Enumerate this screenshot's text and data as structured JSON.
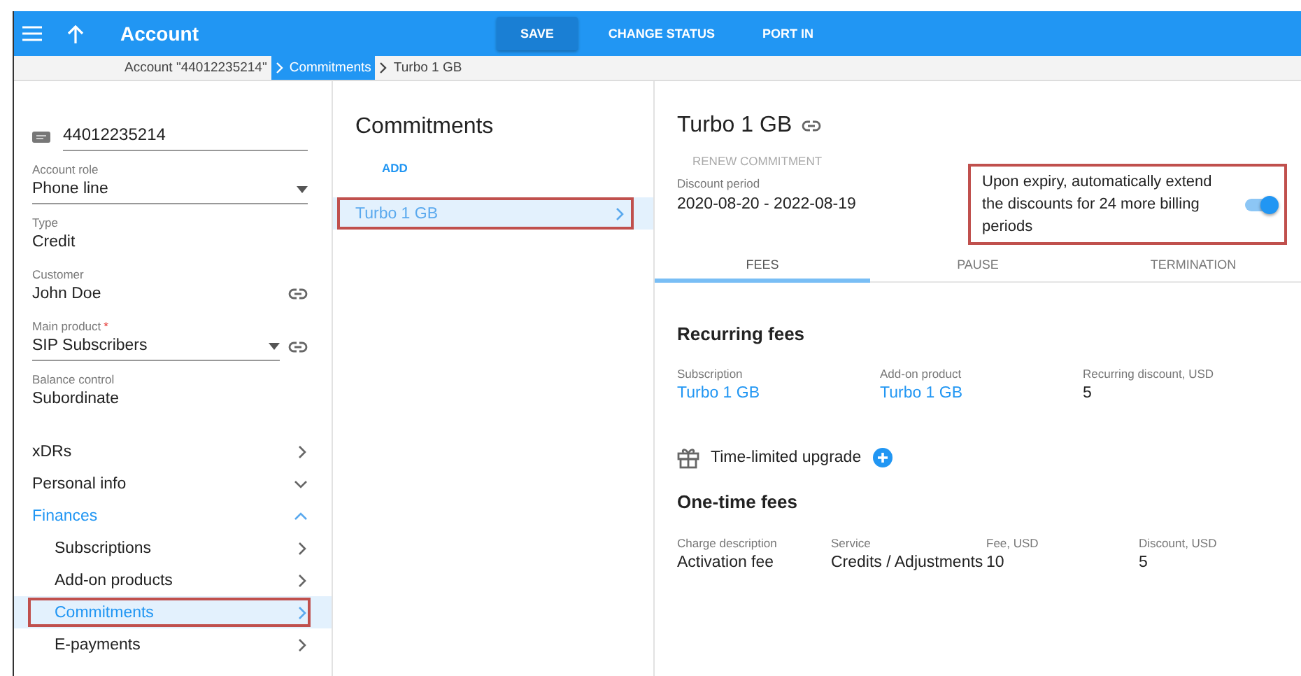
{
  "header": {
    "title": "Account",
    "actions": [
      {
        "label": "SAVE",
        "kind": "primary"
      },
      {
        "label": "CHANGE STATUS",
        "kind": "flat"
      },
      {
        "label": "PORT IN",
        "kind": "flat"
      }
    ]
  },
  "breadcrumbs": [
    {
      "label": "Account \"44012235214\"",
      "selected": false
    },
    {
      "label": "Commitments",
      "selected": true
    },
    {
      "label": "Turbo 1 GB",
      "selected": false
    }
  ],
  "sidebar": {
    "account_id": "44012235214",
    "fields": [
      {
        "label": "Account role",
        "value": "Phone line",
        "kind": "dropdown"
      },
      {
        "label": "Type",
        "value": "Credit",
        "kind": "text"
      },
      {
        "label": "Customer",
        "value": "John Doe",
        "kind": "link"
      },
      {
        "label": "Main product",
        "mark": "*",
        "value": "SIP Subscribers",
        "kind": "dropdown-link"
      },
      {
        "label": "Balance control",
        "value": "Subordinate",
        "kind": "text"
      }
    ],
    "nav": [
      {
        "label": "xDRs",
        "kind": "link",
        "expanded": false
      },
      {
        "label": "Personal info",
        "kind": "group",
        "expanded": false
      },
      {
        "label": "Finances",
        "kind": "group",
        "expanded": true,
        "children": [
          {
            "label": "Subscriptions",
            "selected": false,
            "highlighted": false
          },
          {
            "label": "Add-on products",
            "selected": false,
            "highlighted": false
          },
          {
            "label": "Commitments",
            "selected": true,
            "highlighted": true
          },
          {
            "label": "E-payments",
            "selected": false,
            "highlighted": false
          }
        ]
      }
    ]
  },
  "commitments": {
    "title": "Commitments",
    "add": "ADD",
    "items": [
      {
        "label": "Turbo 1 GB",
        "selected": true,
        "highlighted": true
      }
    ]
  },
  "detail": {
    "title": "Turbo 1 GB",
    "renew": {
      "label": "RENEW COMMITMENT",
      "disabled": true
    },
    "discount_period": {
      "label": "Discount period",
      "value": "2020-08-20 - 2022-08-19"
    },
    "auto_extend": {
      "text": "Upon expiry, automatically extend the discounts for 24 more billing periods",
      "on": true,
      "highlighted": true
    },
    "tabs": [
      {
        "label": "FEES",
        "selected": true
      },
      {
        "label": "PAUSE",
        "selected": false
      },
      {
        "label": "TERMINATION",
        "selected": false
      }
    ],
    "recurring_fees": {
      "title": "Recurring fees",
      "fields": [
        {
          "label": "Subscription",
          "value": "Turbo 1 GB",
          "kind": "link"
        },
        {
          "label": "Add-on product",
          "value": "Turbo 1 GB",
          "kind": "link"
        },
        {
          "label": "Recurring discount, USD",
          "value": "5",
          "kind": "text"
        }
      ]
    },
    "upgrade": {
      "label": "Time-limited upgrade"
    },
    "one_time_fees": {
      "title": "One-time fees",
      "columns": [
        "Charge description",
        "Service",
        "Fee, USD",
        "Discount, USD"
      ],
      "rows": [
        [
          "Activation fee",
          "Credits / Adjustments",
          "10",
          "5"
        ]
      ]
    }
  }
}
